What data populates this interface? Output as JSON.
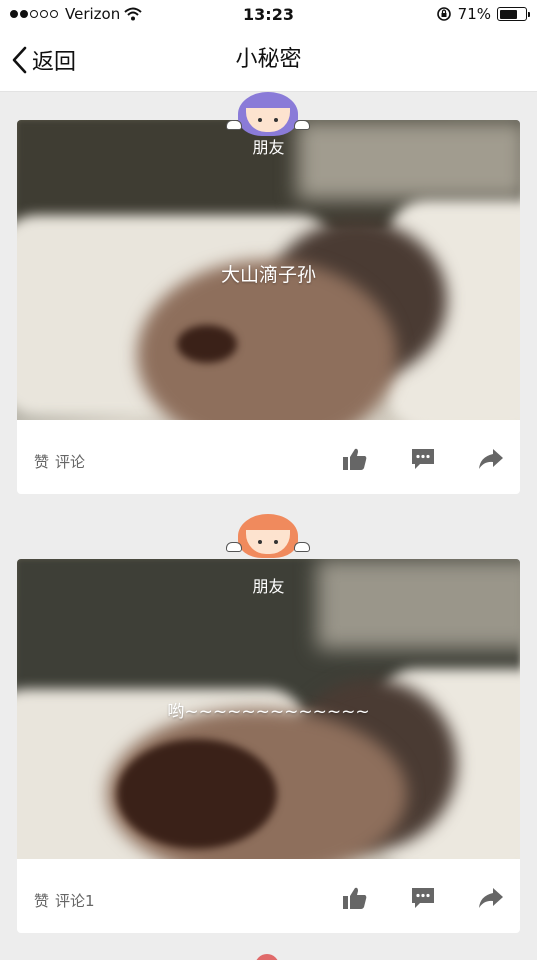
{
  "status_bar": {
    "carrier": "Verizon",
    "time": "13:23",
    "battery_percent": "71%",
    "battery_level": 0.71
  },
  "nav": {
    "back_label": "返回",
    "title": "小秘密"
  },
  "posts": [
    {
      "friend_label": "朋友",
      "caption": "大山滴子孙",
      "like_label": "赞",
      "comment_label": "评论",
      "avatar_color": "#8a7bd8"
    },
    {
      "friend_label": "朋友",
      "caption": "哟~~~~~~~~~~~~~",
      "like_label": "赞",
      "comment_label": "评论1",
      "avatar_color": "#f08a5d"
    }
  ],
  "icons": {
    "like": "thumbs-up-icon",
    "comment": "comment-icon",
    "share": "share-icon",
    "back": "chevron-left-icon",
    "wifi": "wifi-icon",
    "lock": "rotation-lock-icon",
    "battery": "battery-icon"
  }
}
